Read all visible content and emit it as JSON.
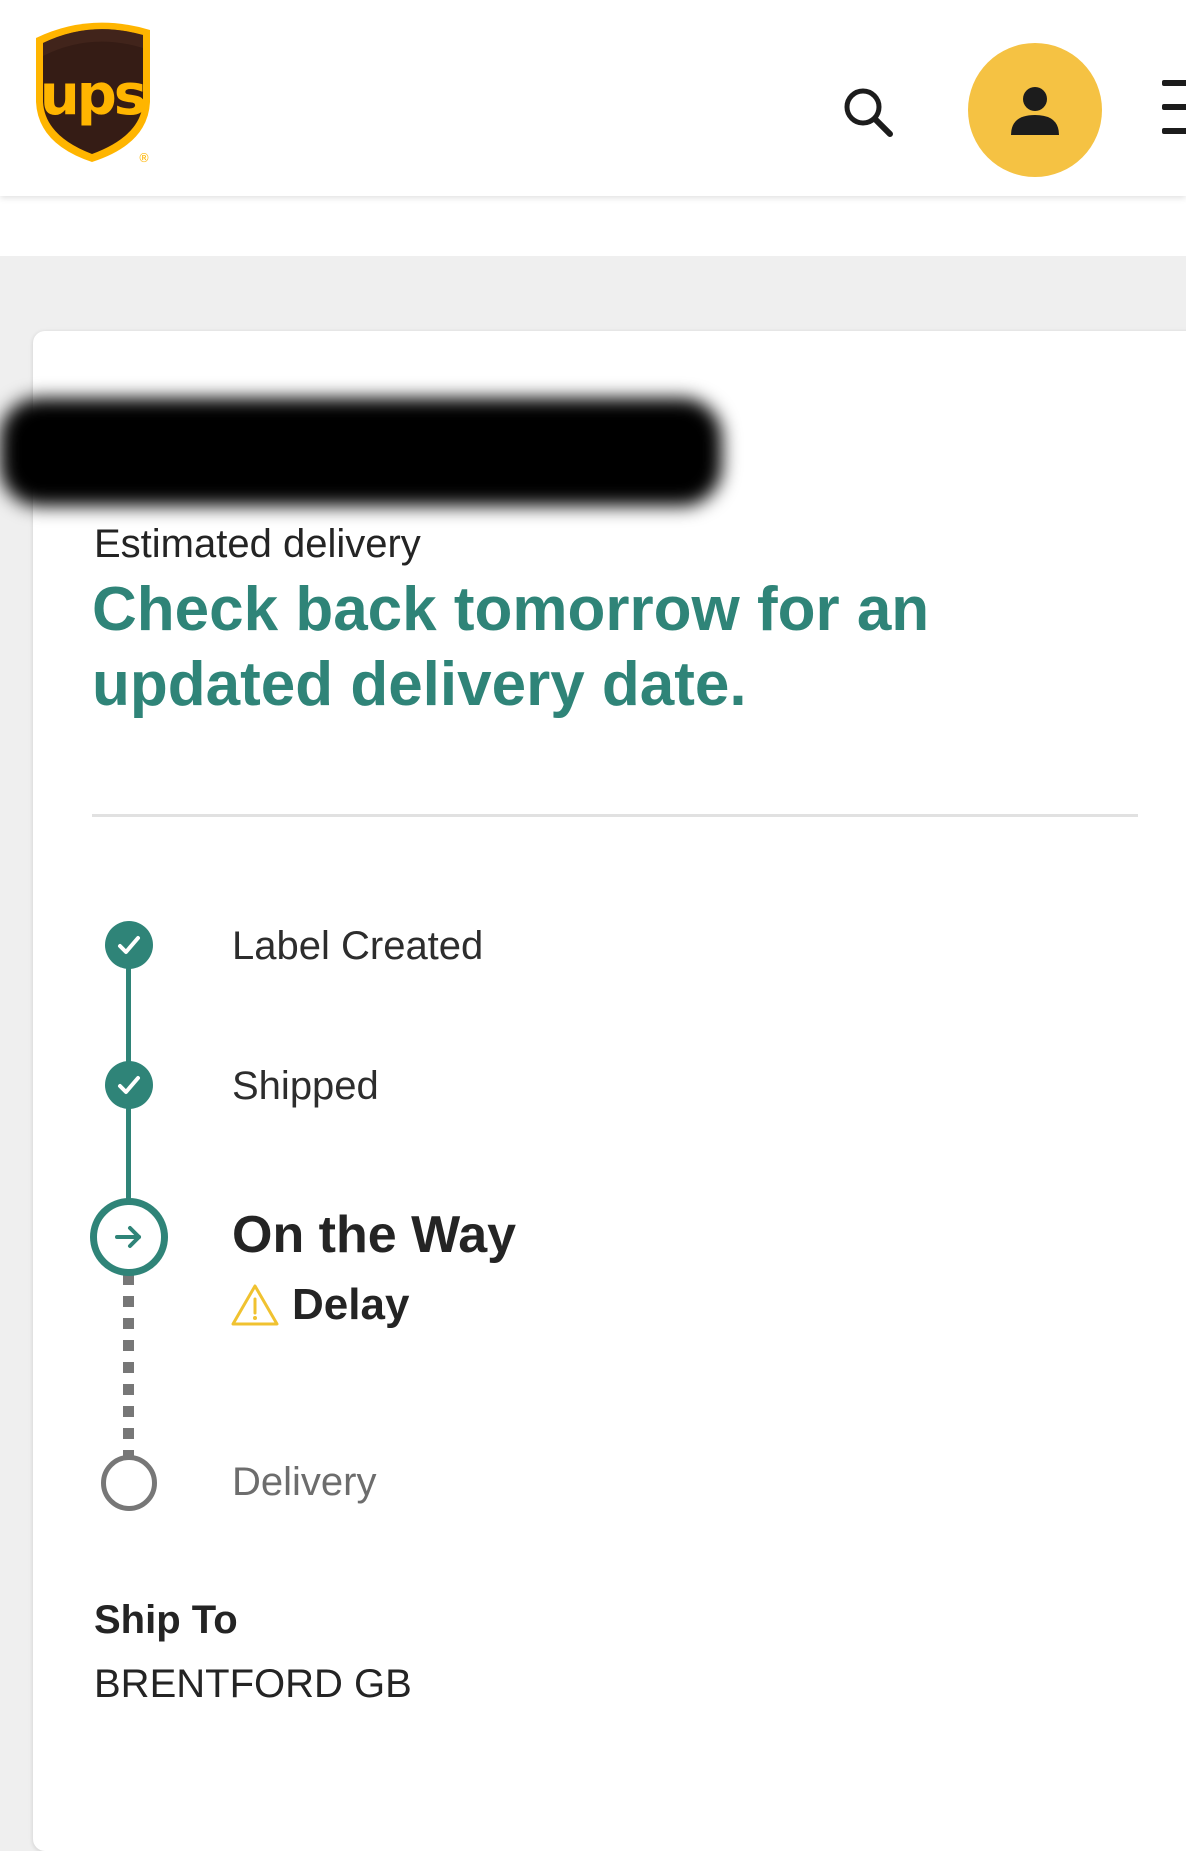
{
  "header": {
    "logo_text": "ups",
    "logo_trademark": "®",
    "icons": {
      "search": "search-icon",
      "account": "user-icon",
      "menu": "hamburger-menu-icon"
    },
    "colors": {
      "logo_brown": "#351c15",
      "logo_gold": "#ffb500",
      "account_bg": "#f5c243"
    }
  },
  "shipment": {
    "estimated_label": "Estimated delivery",
    "estimated_message": "Check back tomorrow for an updated delivery date."
  },
  "tracker": {
    "steps": [
      {
        "label": "Label Created",
        "status": "complete"
      },
      {
        "label": "Shipped",
        "status": "complete"
      },
      {
        "label": "On the Way",
        "status": "current",
        "alert": "Delay",
        "alert_icon": "warning-icon"
      },
      {
        "label": "Delivery",
        "status": "pending"
      }
    ],
    "colors": {
      "complete": "#2f8478",
      "pending": "#777777",
      "warning": "#f0c230"
    }
  },
  "ship_to": {
    "label": "Ship To",
    "value": "BRENTFORD GB"
  }
}
